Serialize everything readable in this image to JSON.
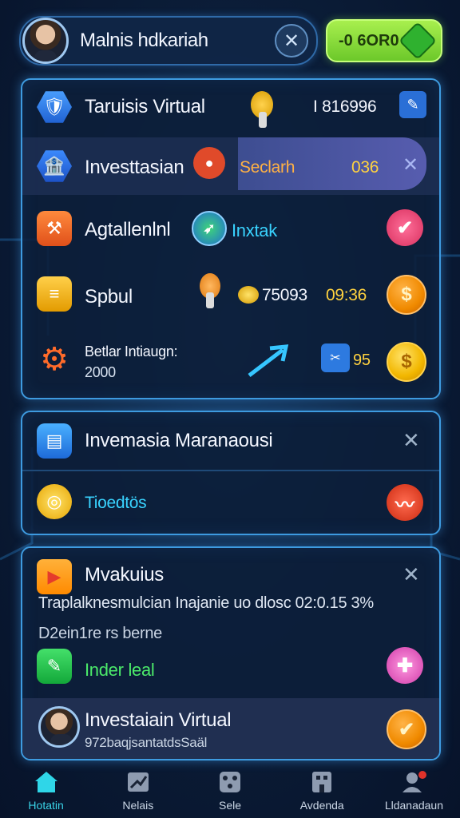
{
  "header": {
    "player_name": "Malnis hdkariah",
    "close_symbol": "✕",
    "wallet_text": "-0 6OR0"
  },
  "panel1": {
    "row1": {
      "title": "Taruisis Virtual",
      "value": "I 816996"
    },
    "row2": {
      "title": "Investtasian",
      "search_label": "Seclarh",
      "search_value": "036",
      "close_symbol": "✕"
    },
    "row3": {
      "title": "Agtallenlnl",
      "tag": "Inxtak"
    },
    "row4": {
      "title": "Spbul",
      "coins": "75093",
      "time": "09:36",
      "badge_symbol": "$"
    },
    "row5": {
      "title": "Betlar Intiaugn:",
      "sub": "2000",
      "count": "95",
      "badge_symbol": "$"
    }
  },
  "panel2": {
    "title": "Invemasia Maranaousi",
    "close_symbol": "✕",
    "item_label": "Tioedtös"
  },
  "panel3": {
    "title": "Mvakuius",
    "close_symbol": "✕",
    "line1": "Traplalknesmulcian Inajanie uo dlosc 02:0.15 3%",
    "line2": "D2ein1re rs berne",
    "item_label": "Inder leal",
    "footer_title": "Investaiain Virtual",
    "footer_sub": "972baqjsantatdsSaäl"
  },
  "nav": [
    {
      "label": "Hotatin",
      "icon": "home-icon",
      "active": true
    },
    {
      "label": "Nelais",
      "icon": "chart-icon"
    },
    {
      "label": "Sele",
      "icon": "dice-icon"
    },
    {
      "label": "Avdenda",
      "icon": "building-icon"
    },
    {
      "label": "Lldanadaun",
      "icon": "profile-icon"
    }
  ],
  "colors": {
    "accent": "#3e9be0",
    "wallet": "#8fdc3c",
    "panel_bg": "#0d1f3a",
    "active_nav": "#3ad4e8"
  }
}
